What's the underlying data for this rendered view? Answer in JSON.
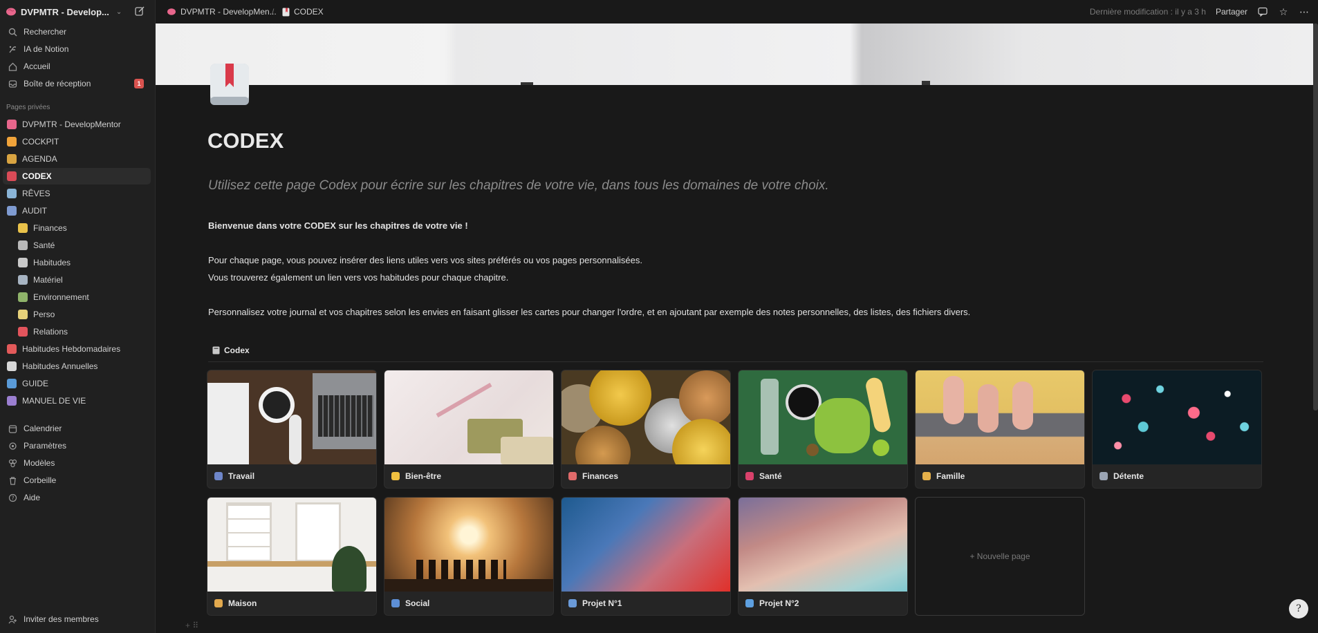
{
  "workspace": {
    "name": "DVPMTR - Develop..."
  },
  "sidebar": {
    "top": [
      {
        "label": "Rechercher",
        "icon": "search-icon"
      },
      {
        "label": "IA de Notion",
        "icon": "ai-icon"
      },
      {
        "label": "Accueil",
        "icon": "home-icon"
      },
      {
        "label": "Boîte de réception",
        "icon": "inbox-icon",
        "badge": "1"
      }
    ],
    "section_label": "Pages privées",
    "pages": [
      {
        "label": "DVPMTR - DevelopMentor",
        "color": "#e8668c"
      },
      {
        "label": "COCKPIT",
        "color": "#f0a33a"
      },
      {
        "label": "AGENDA",
        "color": "#d9a441"
      },
      {
        "label": "CODEX",
        "color": "#d94b57"
      },
      {
        "label": "RÊVES",
        "color": "#8ab4d6"
      },
      {
        "label": "AUDIT",
        "color": "#7f9bd1"
      },
      {
        "label": "Finances",
        "color": "#e9c24a",
        "child": true
      },
      {
        "label": "Santé",
        "color": "#b9b9b9",
        "child": true
      },
      {
        "label": "Habitudes",
        "color": "#c9c9c9",
        "child": true
      },
      {
        "label": "Matériel",
        "color": "#a7b4c2",
        "child": true
      },
      {
        "label": "Environnement",
        "color": "#8fb36a",
        "child": true
      },
      {
        "label": "Perso",
        "color": "#e6d17a",
        "child": true
      },
      {
        "label": "Relations",
        "color": "#e2545c",
        "child": true
      },
      {
        "label": "Habitudes Hebdomadaires",
        "color": "#e35a5a"
      },
      {
        "label": "Habitudes Annuelles",
        "color": "#d8d8d8"
      },
      {
        "label": "GUIDE",
        "color": "#5a9bd8"
      },
      {
        "label": "MANUEL DE VIE",
        "color": "#9b7fd1"
      }
    ],
    "bottom": [
      {
        "label": "Calendrier",
        "icon": "calendar-icon"
      },
      {
        "label": "Paramètres",
        "icon": "settings-icon"
      },
      {
        "label": "Modèles",
        "icon": "templates-icon"
      },
      {
        "label": "Corbeille",
        "icon": "trash-icon"
      },
      {
        "label": "Aide",
        "icon": "help-icon"
      }
    ],
    "invite": "Inviter des membres"
  },
  "topbar": {
    "crumb1": "DVPMTR - DevelopMen...",
    "sep": "/",
    "crumb2": "CODEX",
    "last_edit": "Dernière modification : il y a 3 h",
    "share": "Partager"
  },
  "page": {
    "title": "CODEX",
    "quote": "Utilisez cette page Codex pour écrire sur les chapitres de votre vie, dans tous les domaines de votre choix.",
    "p1": "Bienvenue dans votre CODEX sur les chapitres de votre vie !",
    "p2": "Pour chaque page, vous pouvez insérer des liens utiles vers vos sites préférés ou vos pages personnalisées.",
    "p3": "Vous trouverez également un lien vers vos habitudes pour chaque chapitre.",
    "p4": "Personnalisez votre journal et vos chapitres selon les envies en faisant glisser les cartes pour changer l'ordre, et en ajoutant par exemple des notes personnelles, des listes, des fichiers divers."
  },
  "database": {
    "title": "Codex",
    "cards": [
      {
        "label": "Travail",
        "color": "#6e86c9"
      },
      {
        "label": "Bien-être",
        "color": "#f0c040"
      },
      {
        "label": "Finances",
        "color": "#e06a6a"
      },
      {
        "label": "Santé",
        "color": "#d9416b"
      },
      {
        "label": "Famille",
        "color": "#e5b04a"
      },
      {
        "label": "Détente",
        "color": "#9aa4b3"
      },
      {
        "label": "Maison",
        "color": "#e2a94e"
      },
      {
        "label": "Social",
        "color": "#5d8fd6"
      },
      {
        "label": "Projet N°1",
        "color": "#6a9ad8"
      },
      {
        "label": "Projet N°2",
        "color": "#5ea0e0"
      }
    ],
    "new_page": "+ Nouvelle page"
  },
  "help_button": "?"
}
